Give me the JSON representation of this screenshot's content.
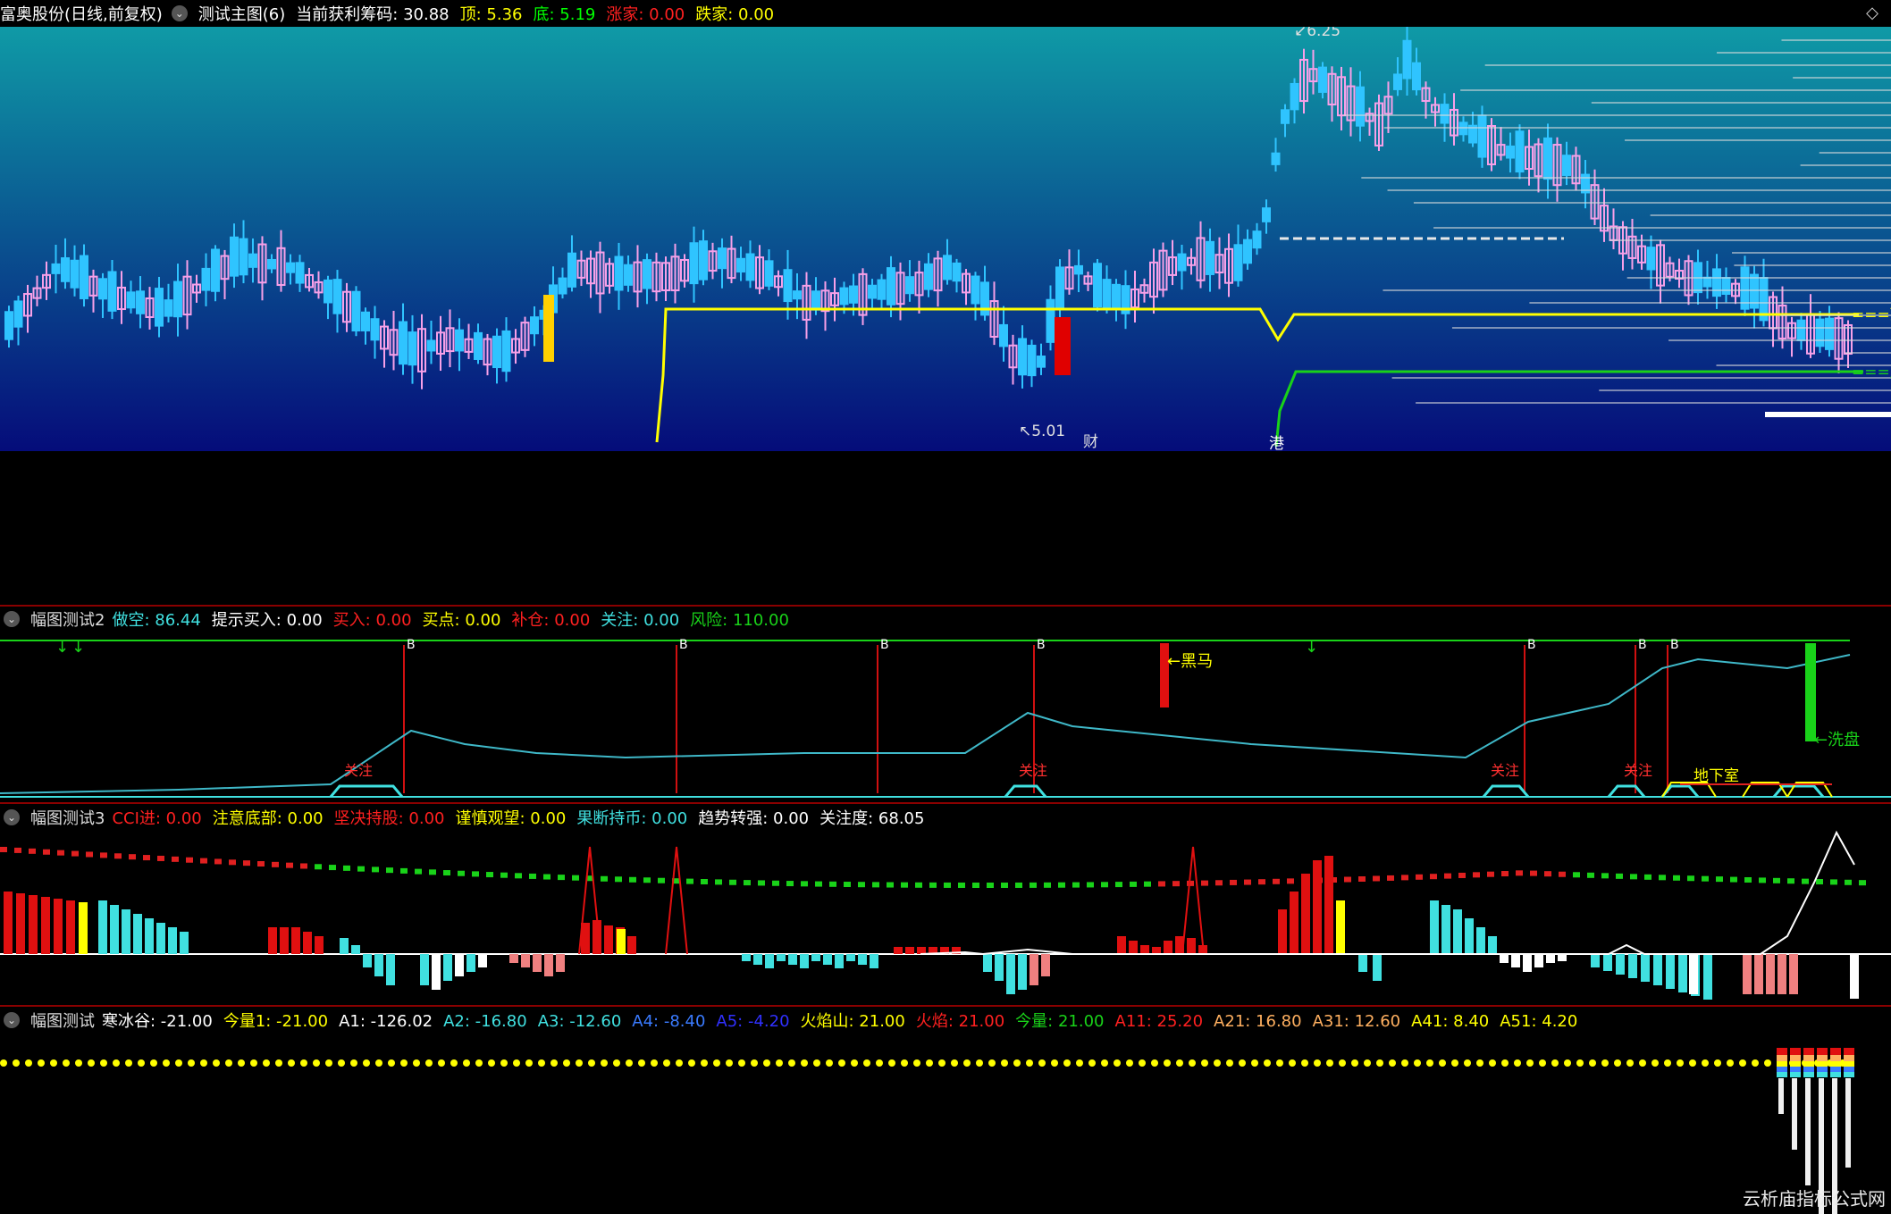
{
  "main": {
    "title": "富奥股份(日线,前复权)",
    "indicator": "测试主图(6)",
    "fields": [
      {
        "label": "当前获利筹码:",
        "value": "30.88",
        "color": "#ffffff"
      },
      {
        "label": "顶:",
        "value": "5.36",
        "color": "#ffff00"
      },
      {
        "label": "底:",
        "value": "5.19",
        "color": "#00ff00"
      },
      {
        "label": "涨家:",
        "value": "0.00",
        "color": "#ff2020"
      },
      {
        "label": "跌家:",
        "value": "0.00",
        "color": "#ffff00"
      }
    ],
    "high_label": "6.25",
    "low_label": "5.01",
    "marker_cai": "财",
    "marker_gang": "港",
    "top_tag": "顶",
    "bottom_tag": "底",
    "colors": {
      "bg_top": "#0f9aa6",
      "bg_bottom": "#050c7a",
      "up": "#f7a0e8",
      "down": "#2fc4ff",
      "ma": "#ffff00",
      "support": "#19d219"
    }
  },
  "panel2": {
    "title": "幅图测试2",
    "fields": [
      {
        "label": "做空:",
        "value": "86.44",
        "color": "#40e0e0"
      },
      {
        "label": "提示买入:",
        "value": "0.00",
        "color": "#ffffff"
      },
      {
        "label": "买入:",
        "value": "0.00",
        "color": "#ff2020"
      },
      {
        "label": "买点:",
        "value": "0.00",
        "color": "#ffff00"
      },
      {
        "label": "补仓:",
        "value": "0.00",
        "color": "#ff2020"
      },
      {
        "label": "关注:",
        "value": "0.00",
        "color": "#40e0e0"
      },
      {
        "label": "风险:",
        "value": "110.00",
        "color": "#19d219"
      }
    ],
    "b_label": "B",
    "heima": "黑马",
    "guanzhu": "关注",
    "dixiashi": "地下室",
    "xipan": "洗盘"
  },
  "panel3": {
    "title": "幅图测试3",
    "fields": [
      {
        "label": "CCI进:",
        "value": "0.00",
        "color": "#ff2020"
      },
      {
        "label": "注意底部:",
        "value": "0.00",
        "color": "#ffff00"
      },
      {
        "label": "坚决持股:",
        "value": "0.00",
        "color": "#ff2020"
      },
      {
        "label": "谨慎观望:",
        "value": "0.00",
        "color": "#ffff00"
      },
      {
        "label": "果断持币:",
        "value": "0.00",
        "color": "#40e0e0"
      },
      {
        "label": "趋势转强:",
        "value": "0.00",
        "color": "#ffffff"
      },
      {
        "label": "关注度:",
        "value": "68.05",
        "color": "#ffffff"
      }
    ]
  },
  "panel4": {
    "title": "幅图测试",
    "fields": [
      {
        "label": "寒冰谷:",
        "value": "-21.00",
        "color": "#ffffff"
      },
      {
        "label": "今量1:",
        "value": "-21.00",
        "color": "#ffff00"
      },
      {
        "label": "A1:",
        "value": "-126.02",
        "color": "#ffffff"
      },
      {
        "label": "A2:",
        "value": "-16.80",
        "color": "#40e0e0"
      },
      {
        "label": "A3:",
        "value": "-12.60",
        "color": "#40e0e0"
      },
      {
        "label": "A4:",
        "value": "-8.40",
        "color": "#3a7bff"
      },
      {
        "label": "A5:",
        "value": "-4.20",
        "color": "#3030ff"
      },
      {
        "label": "火焰山:",
        "value": "21.00",
        "color": "#ffff00"
      },
      {
        "label": "火焰:",
        "value": "21.00",
        "color": "#ff2020"
      },
      {
        "label": "今量:",
        "value": "21.00",
        "color": "#19d219"
      },
      {
        "label": "A11:",
        "value": "25.20",
        "color": "#ff2020"
      },
      {
        "label": "A21:",
        "value": "16.80",
        "color": "#ffb060"
      },
      {
        "label": "A31:",
        "value": "12.60",
        "color": "#ffb060"
      },
      {
        "label": "A41:",
        "value": "8.40",
        "color": "#ffff00"
      },
      {
        "label": "A51:",
        "value": "4.20",
        "color": "#ffff00"
      }
    ]
  },
  "watermark": "云析庙指标公式网"
}
